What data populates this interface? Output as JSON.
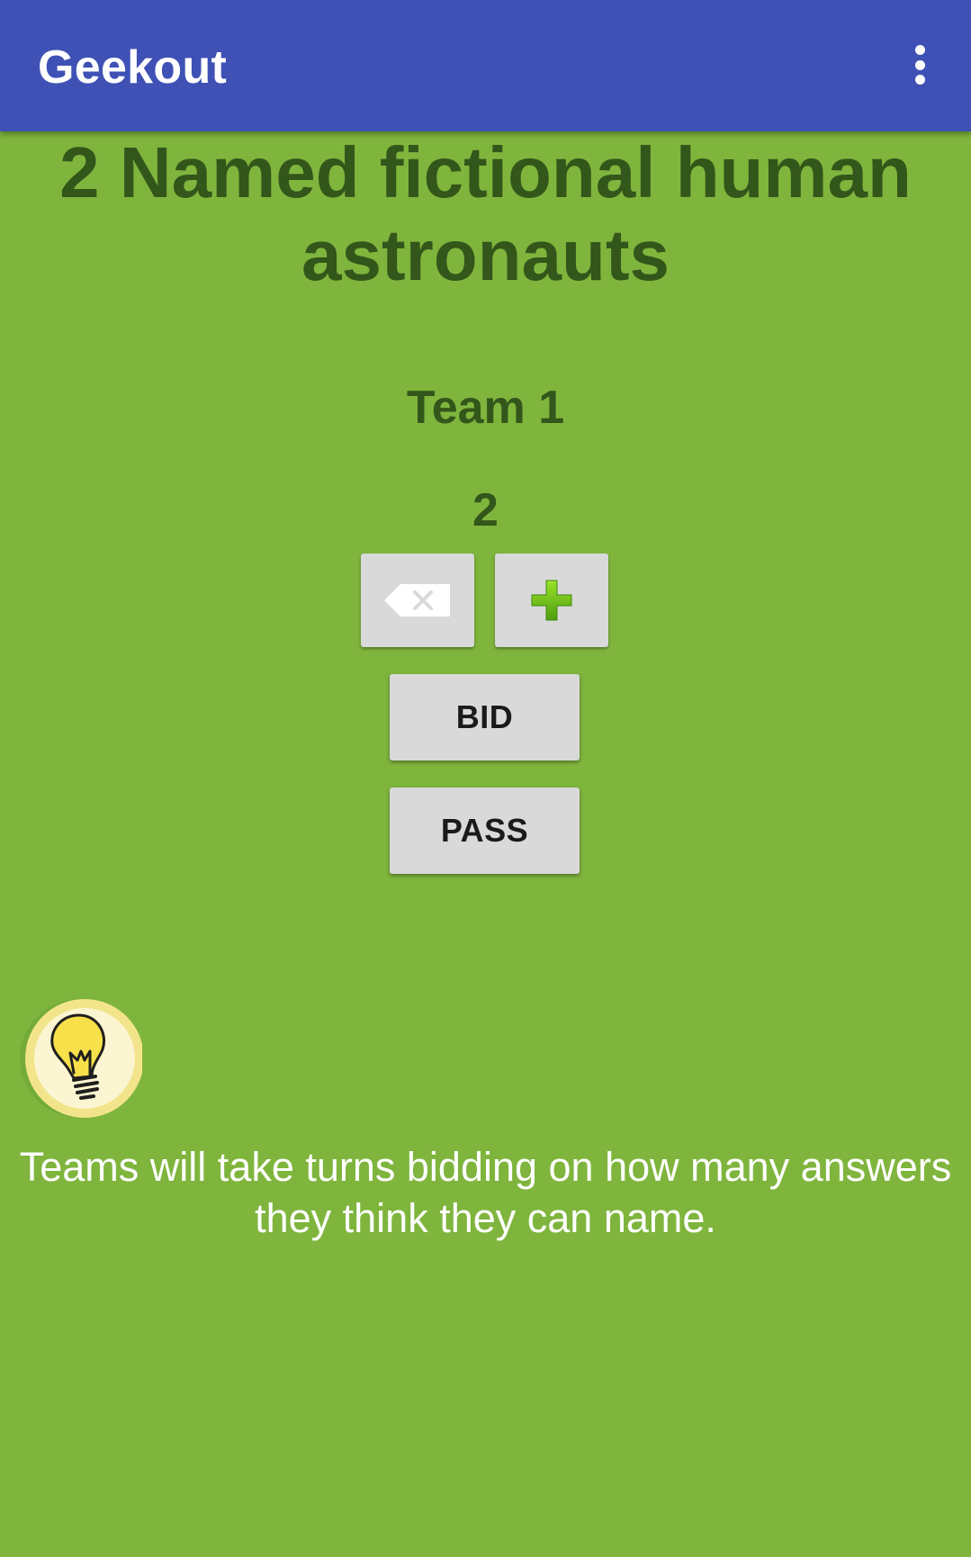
{
  "app_bar": {
    "title": "Geekout",
    "menu_icon": "more-vert-icon"
  },
  "card": {
    "category_title": "2 Named fictional human astronauts"
  },
  "bidding": {
    "team_name": "Team 1",
    "bid_value": "2",
    "decrement_icon": "backspace-icon",
    "increment_icon": "plus-icon",
    "bid_label": "BID",
    "pass_label": "PASS"
  },
  "hint": {
    "icon": "lightbulb-icon",
    "text": "Teams will take turns bidding on how many answers they think they can name."
  },
  "colors": {
    "app_bar": "#3f51b5",
    "background": "#7fb53d",
    "title_text": "#33561a",
    "button_bg": "#d9d9d9",
    "plus_green": "#6cbe14"
  }
}
